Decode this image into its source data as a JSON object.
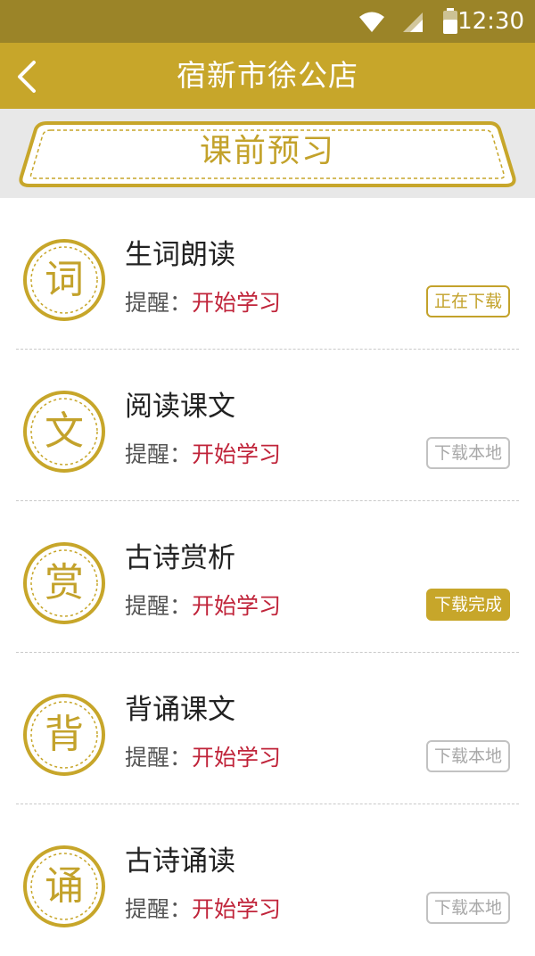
{
  "status_bar": {
    "time": "12:30",
    "icons": [
      "wifi-icon",
      "cell-signal-icon",
      "battery-icon"
    ]
  },
  "nav": {
    "title": "宿新市徐公店",
    "back_icon": "chevron-left-icon"
  },
  "banner": {
    "title": "课前预习"
  },
  "colors": {
    "status_bar": "#9b8428",
    "nav_bar": "#c7a62a",
    "gold_accent": "#c3a22b",
    "link_red": "#c0243a"
  },
  "lessons": [
    {
      "seal_char": "词",
      "title": "生词朗读",
      "reminder_label": "提醒：",
      "reminder_link": "开始学习",
      "download_label": "正在下载",
      "download_state": "downloading"
    },
    {
      "seal_char": "文",
      "title": "阅读课文",
      "reminder_label": "提醒：",
      "reminder_link": "开始学习",
      "download_label": "下载本地",
      "download_state": "idle"
    },
    {
      "seal_char": "赏",
      "title": "古诗赏析",
      "reminder_label": "提醒：",
      "reminder_link": "开始学习",
      "download_label": "下载完成",
      "download_state": "done"
    },
    {
      "seal_char": "背",
      "title": "背诵课文",
      "reminder_label": "提醒：",
      "reminder_link": "开始学习",
      "download_label": "下载本地",
      "download_state": "idle"
    },
    {
      "seal_char": "诵",
      "title": "古诗诵读",
      "reminder_label": "提醒：",
      "reminder_link": "开始学习",
      "download_label": "下载本地",
      "download_state": "idle"
    }
  ]
}
